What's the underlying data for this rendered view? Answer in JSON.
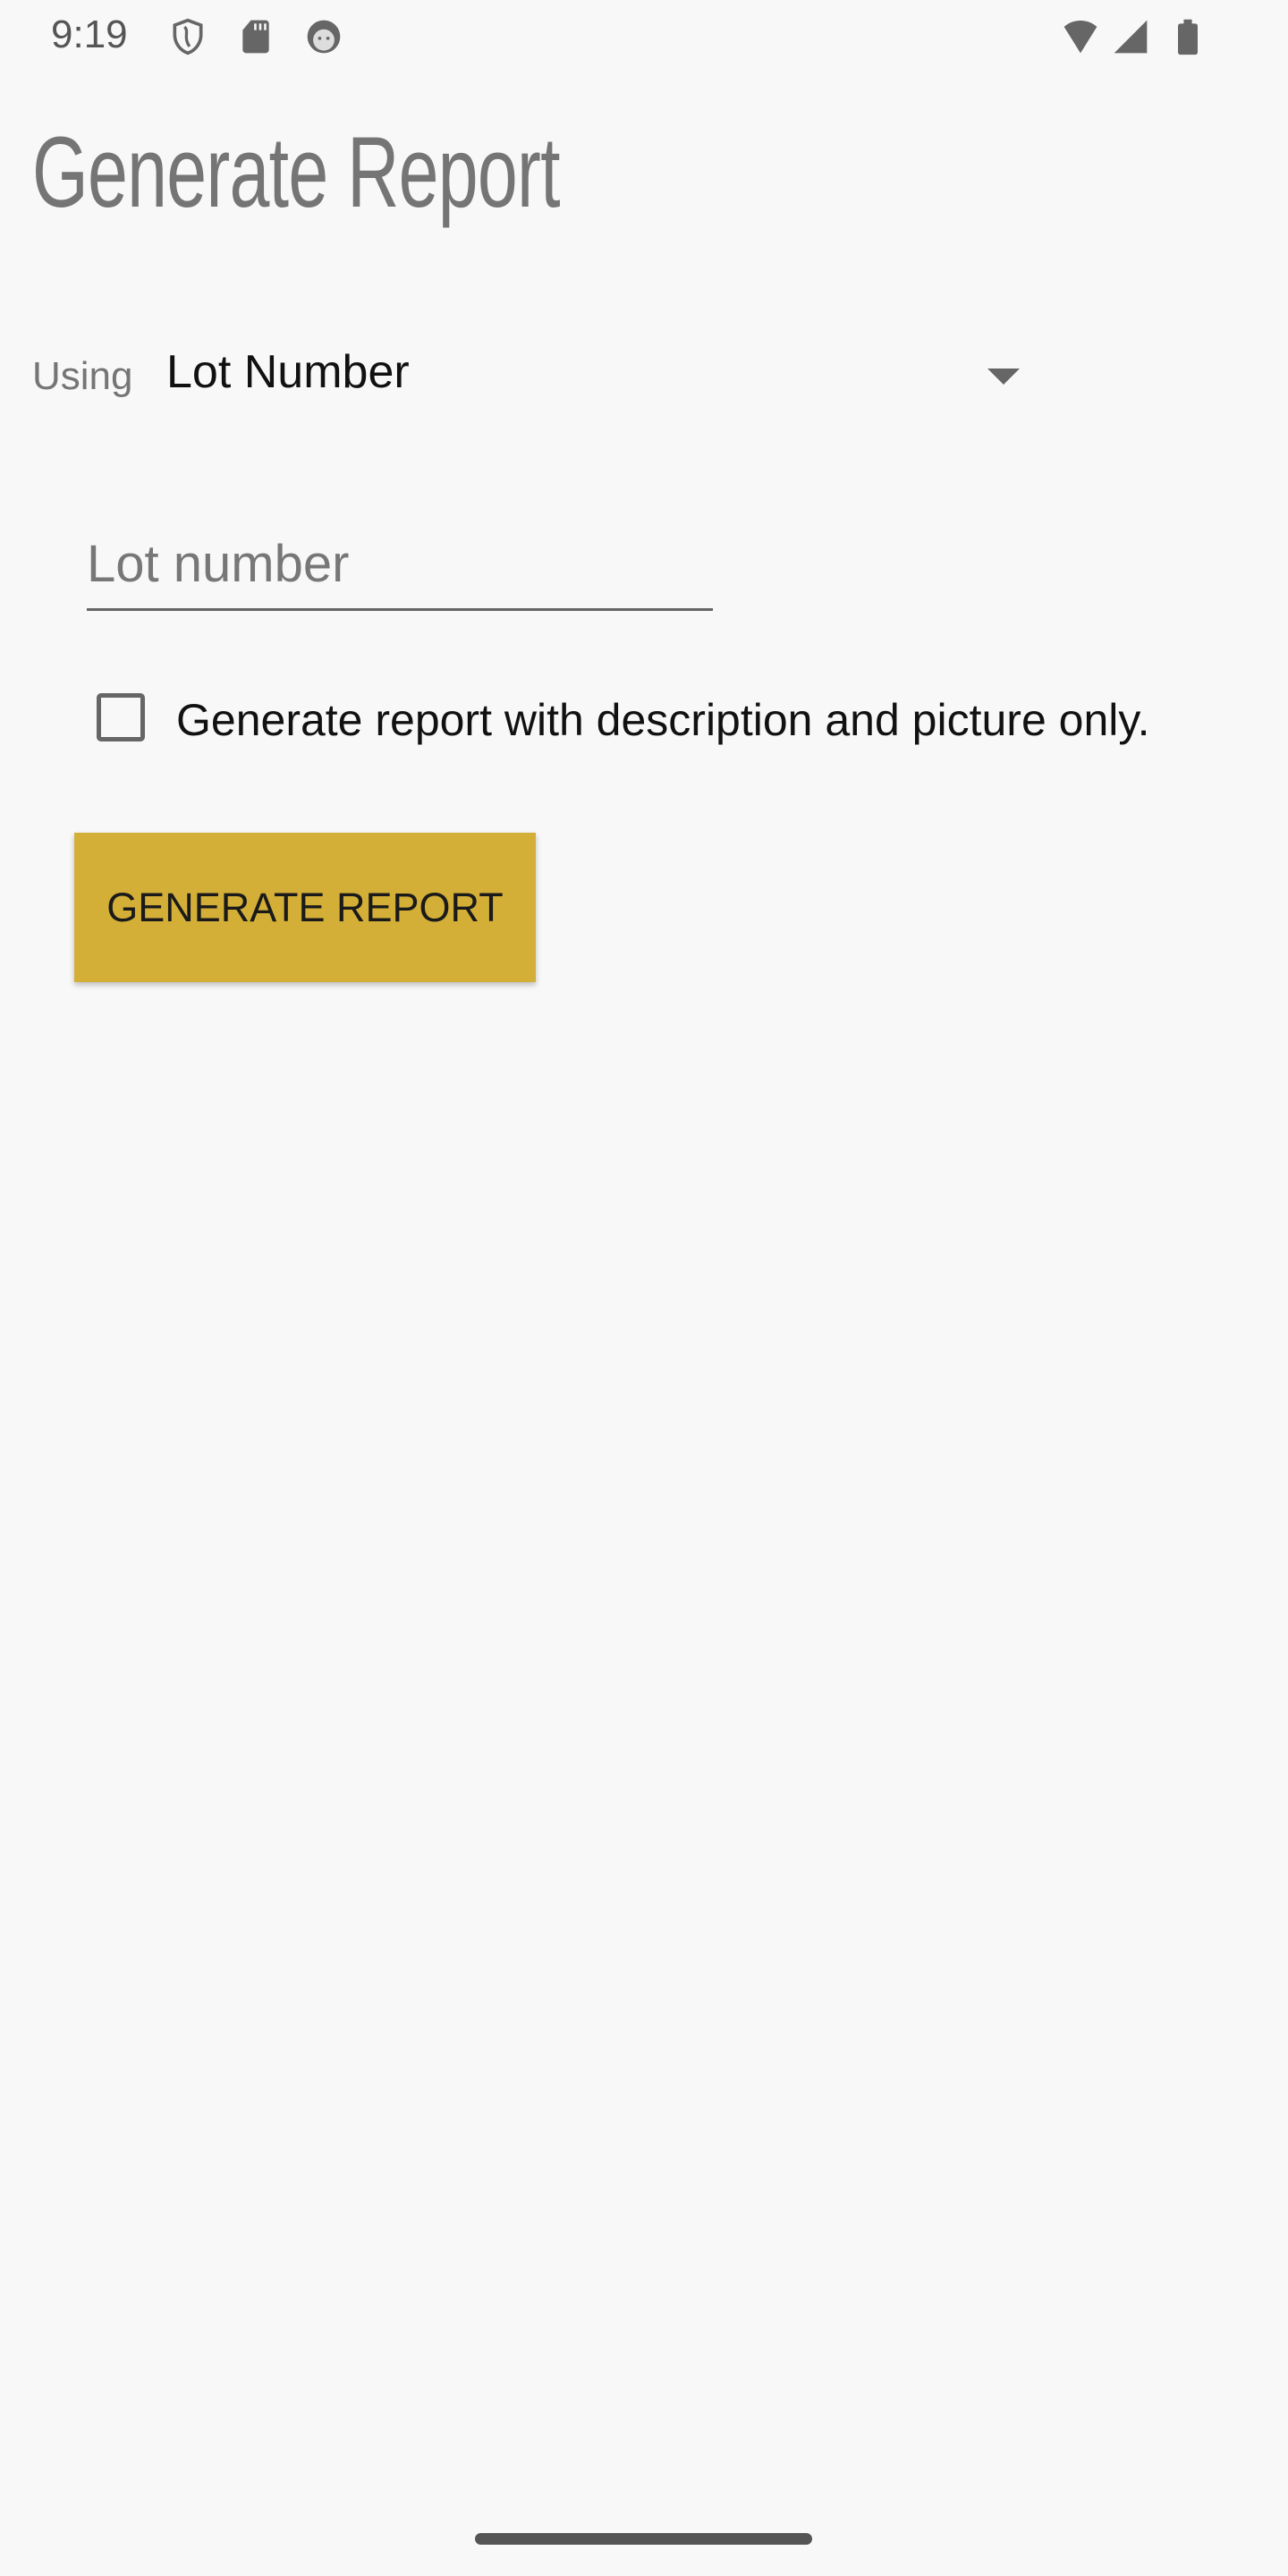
{
  "status_bar": {
    "time": "9:19",
    "left_icons": [
      "shield-icon",
      "sd-card-icon",
      "cat-face-icon"
    ],
    "right_icons": [
      "wifi-icon",
      "signal-icon",
      "battery-icon"
    ]
  },
  "page": {
    "title": "Generate Report"
  },
  "form": {
    "using_label": "Using",
    "using_selected": "Lot Number",
    "lot_placeholder": "Lot number",
    "lot_value": "",
    "checkbox_label": "Generate report with description and picture only.",
    "checkbox_checked": false,
    "submit_label": "GENERATE REPORT"
  },
  "colors": {
    "accent": "#d4af37",
    "background": "#f8f8f8"
  }
}
